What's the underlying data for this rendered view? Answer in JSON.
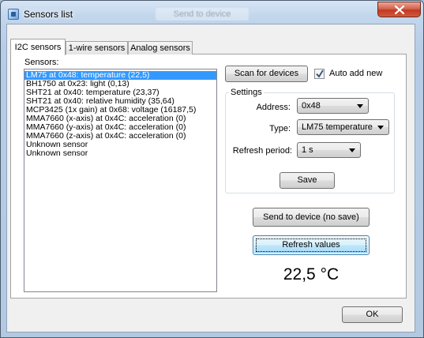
{
  "window": {
    "title": "Sensors list",
    "ghost_title": "Send to device",
    "close_glyph": "x"
  },
  "tabs": [
    {
      "label": "I2C sensors",
      "active": true
    },
    {
      "label": "1-wire sensors",
      "active": false
    },
    {
      "label": "Analog sensors",
      "active": false
    }
  ],
  "sensors": {
    "label": "Sensors:",
    "items": [
      {
        "text": "LM75 at 0x48: temperature (22,5)",
        "selected": true
      },
      {
        "text": "BH1750 at 0x23: light (0,13)"
      },
      {
        "text": "SHT21 at 0x40: temperature (23,37)"
      },
      {
        "text": "SHT21 at 0x40: relative humidity (35,64)"
      },
      {
        "text": "MCP3425 (1x gain) at 0x68: voltage (16187,5)"
      },
      {
        "text": "MMA7660 (x-axis) at 0x4C: acceleration (0)"
      },
      {
        "text": "MMA7660 (y-axis) at 0x4C: acceleration (0)"
      },
      {
        "text": "MMA7660 (z-axis) at 0x4C: acceleration (0)"
      },
      {
        "text": "Unknown sensor"
      },
      {
        "text": "Unknown sensor"
      }
    ]
  },
  "scan": {
    "button_label": "Scan for devices",
    "auto_add_label": "Auto add new",
    "auto_add_checked": true
  },
  "settings": {
    "legend": "Settings",
    "address_label": "Address:",
    "address_value": "0x48",
    "type_label": "Type:",
    "type_value": "LM75 temperature",
    "refresh_label": "Refresh period:",
    "refresh_value": "1 s",
    "save_label": "Save"
  },
  "actions": {
    "send_label": "Send to device (no save)",
    "refresh_label": "Refresh values",
    "temperature_display": "22,5 °C",
    "ok_label": "OK"
  },
  "colors": {
    "selection": "#3399ff",
    "close_button": "#c0391f"
  },
  "icons": {
    "app": "app-window-icon",
    "close": "close-icon",
    "dropdown": "chevron-down-icon",
    "check": "check-icon"
  }
}
